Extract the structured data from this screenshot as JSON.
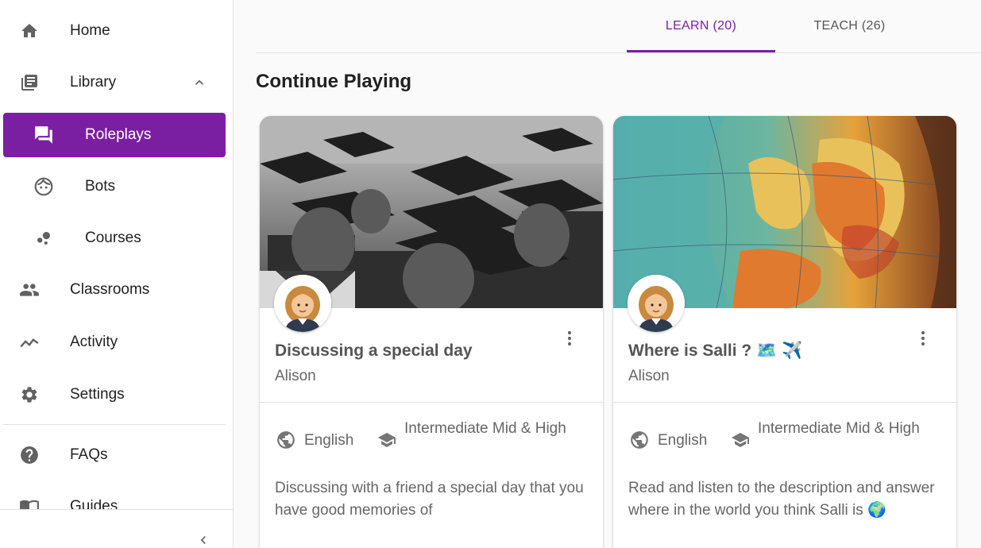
{
  "sidebar": {
    "items": [
      {
        "label": "Home"
      },
      {
        "label": "Library"
      },
      {
        "label": "Roleplays"
      },
      {
        "label": "Bots"
      },
      {
        "label": "Courses"
      },
      {
        "label": "Classrooms"
      },
      {
        "label": "Activity"
      },
      {
        "label": "Settings"
      },
      {
        "label": "FAQs"
      },
      {
        "label": "Guides"
      }
    ],
    "active_color": "#7b1fa2"
  },
  "tabs": [
    {
      "label": "LEARN (20)",
      "active": true
    },
    {
      "label": "TEACH (26)",
      "active": false
    }
  ],
  "section_title": "Continue Playing",
  "cards": [
    {
      "title": "Discussing a special day",
      "author": "Alison",
      "language": "English",
      "level": "Intermediate Mid & High",
      "description": "Discussing with a friend a special day that you have good memories of"
    },
    {
      "title": "Where is Salli ? 🗺️ ✈️",
      "author": "Alison",
      "language": "English",
      "level": "Intermediate Mid & High",
      "description": "Read and listen to the description and answer where in the world you think Salli is 🌍"
    }
  ]
}
